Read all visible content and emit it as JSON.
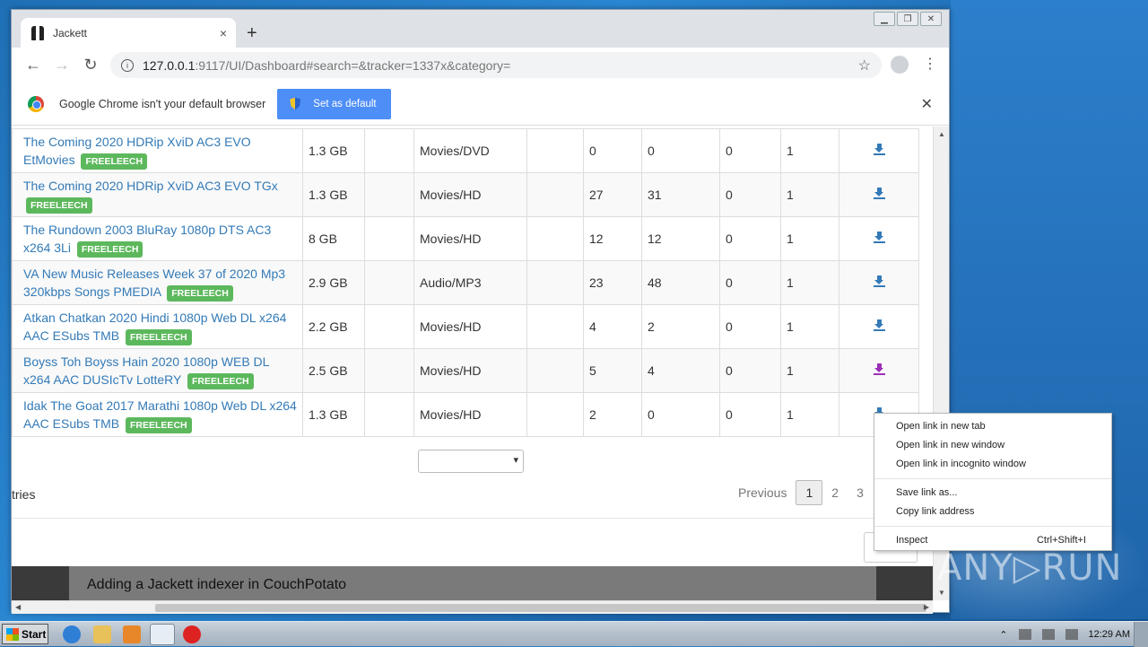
{
  "browser": {
    "tab_title": "Jackett",
    "tab_close": "×",
    "new_tab": "+",
    "url_host": "127.0.0.1",
    "url_rest": ":9117/UI/Dashboard#search=&tracker=1337x&category=",
    "infobar_message": "Google Chrome isn't your default browser",
    "set_default_label": "Set as default",
    "infobar_close": "✕"
  },
  "results": {
    "badge": "FREELEECH",
    "rows": [
      {
        "title": "The Coming 2020 HDRip XviD AC3 EVO EtMovies",
        "size": "1.3 GB",
        "category": "Movies/DVD",
        "seeds": "0",
        "peers": "0",
        "grabs": "0",
        "dl_factor": "1",
        "link_color": "#337ab7"
      },
      {
        "title": "The Coming 2020 HDRip XviD AC3 EVO TGx",
        "size": "1.3 GB",
        "category": "Movies/HD",
        "seeds": "27",
        "peers": "31",
        "grabs": "0",
        "dl_factor": "1",
        "link_color": "#337ab7"
      },
      {
        "title": "The Rundown 2003 BluRay 1080p DTS AC3 x264 3Li",
        "size": "8 GB",
        "category": "Movies/HD",
        "seeds": "12",
        "peers": "12",
        "grabs": "0",
        "dl_factor": "1",
        "link_color": "#337ab7"
      },
      {
        "title": "VA New Music Releases Week 37 of 2020 Mp3 320kbps Songs PMEDIA",
        "size": "2.9 GB",
        "category": "Audio/MP3",
        "seeds": "23",
        "peers": "48",
        "grabs": "0",
        "dl_factor": "1",
        "link_color": "#337ab7"
      },
      {
        "title": "Atkan Chatkan 2020 Hindi 1080p Web DL x264 AAC ESubs TMB",
        "size": "2.2 GB",
        "category": "Movies/HD",
        "seeds": "4",
        "peers": "2",
        "grabs": "0",
        "dl_factor": "1",
        "link_color": "#337ab7"
      },
      {
        "title": "Boyss Toh Boyss Hain 2020 1080p WEB DL x264 AAC DUSIcTv LotteRY",
        "size": "2.5 GB",
        "category": "Movies/HD",
        "seeds": "5",
        "peers": "4",
        "grabs": "0",
        "dl_factor": "1",
        "link_color": "#9b30b8"
      },
      {
        "title": "Idak The Goat 2017 Marathi 1080p Web DL x264 AAC ESubs TMB",
        "size": "1.3 GB",
        "category": "Movies/HD",
        "seeds": "2",
        "peers": "0",
        "grabs": "0",
        "dl_factor": "1",
        "link_color": "#337ab7"
      }
    ]
  },
  "footer": {
    "entries_text": "tries",
    "previous": "Previous",
    "pages": [
      "1",
      "2",
      "3"
    ]
  },
  "video_title": "Adding a Jackett indexer in CouchPotato",
  "context_menu": {
    "items": [
      "Open link in new tab",
      "Open link in new window",
      "Open link in incognito window"
    ],
    "items2": [
      "Save link as...",
      "Copy link address"
    ],
    "inspect": "Inspect",
    "inspect_shortcut": "Ctrl+Shift+I"
  },
  "watermark": "ANY▷RUN",
  "taskbar": {
    "start": "Start",
    "clock": "12:29 AM"
  }
}
